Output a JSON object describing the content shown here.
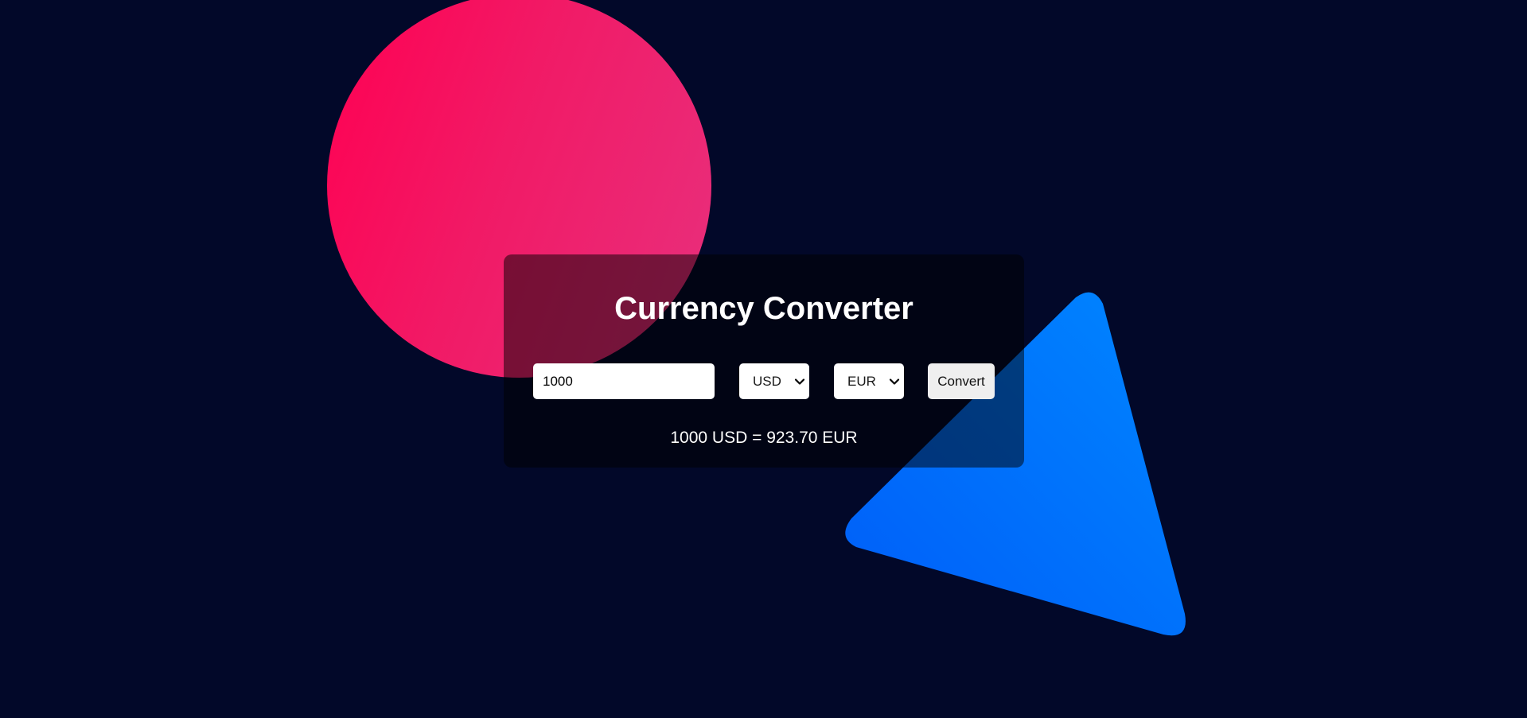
{
  "converter": {
    "title": "Currency Converter",
    "amount_value": "1000",
    "from_currency": "USD",
    "to_currency": "EUR",
    "convert_label": "Convert",
    "result_text": "1000 USD = 923.70 EUR"
  },
  "colors": {
    "background": "#020829",
    "circle_gradient_start": "#ff0052",
    "circle_gradient_end": "#e8307d",
    "triangle_gradient_start": "#005df8",
    "triangle_gradient_end": "#0086ff",
    "card_overlay": "rgba(0,0,0,0.5)"
  }
}
